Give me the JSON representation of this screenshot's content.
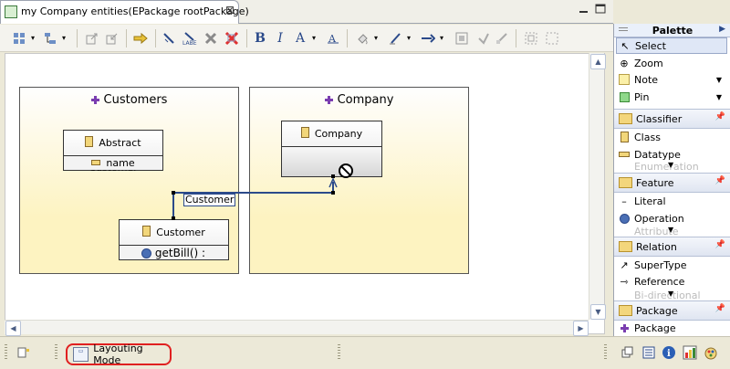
{
  "editor": {
    "tab_title": "my Company entities(EPackage rootPackage)",
    "tab_close": "⊠"
  },
  "toolbar": {
    "icons": [
      "grid-icon",
      "tree-icon",
      "export-icon",
      "import-icon",
      "arrow-right-icon",
      "hide-icon",
      "label-icon",
      "delete-icon",
      "delete-red-icon",
      "bold-icon",
      "italic-icon",
      "font-color-icon",
      "text-format-icon",
      "fill-color-icon",
      "line-color-icon",
      "line-style-icon",
      "snap-icon",
      "undo-route-icon",
      "route-icon",
      "align-icon",
      "distribute-icon"
    ],
    "bold": "B",
    "italic": "I",
    "font": "A"
  },
  "diagram": {
    "packages": [
      {
        "name": "Customers"
      },
      {
        "name": "Company"
      }
    ],
    "classes": {
      "abstract_customer": {
        "name": "Abstract Customer",
        "attribute": "name"
      },
      "customer": {
        "name": "Customer",
        "operation": "getBill() :"
      },
      "company": {
        "name": "Company"
      }
    },
    "relation_label": "Customer"
  },
  "palette": {
    "title": "Palette",
    "tools": [
      "Select",
      "Zoom",
      "Note",
      "Pin"
    ],
    "drawers": [
      {
        "name": "Classifier",
        "items": [
          "Class",
          "Datatype",
          "Enumeration"
        ]
      },
      {
        "name": "Feature",
        "items": [
          "Literal",
          "Operation",
          "Attribute"
        ]
      },
      {
        "name": "Relation",
        "items": [
          "SuperType",
          "Reference",
          "Bi-directional"
        ]
      },
      {
        "name": "Package",
        "items": [
          "Package"
        ]
      }
    ]
  },
  "statusbar": {
    "mode_label": "Layouting Mode"
  }
}
